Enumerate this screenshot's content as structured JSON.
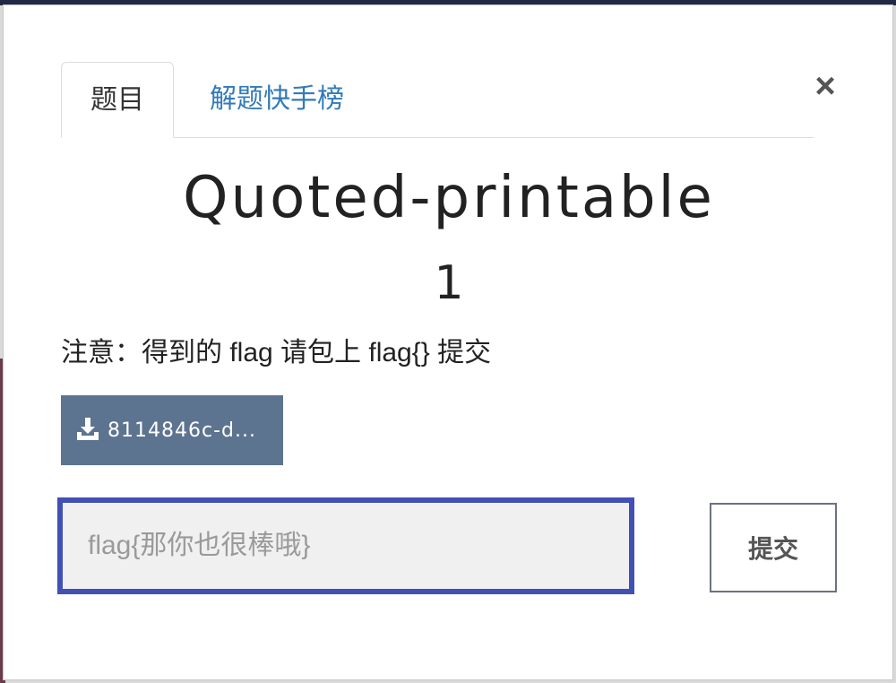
{
  "tabs": [
    {
      "label": "题目",
      "active": true
    },
    {
      "label": "解题快手榜",
      "active": false
    }
  ],
  "close_glyph": "×",
  "challenge": {
    "title": "Quoted-printable",
    "points": "1",
    "note": "注意：得到的 flag 请包上 flag{} 提交",
    "file_label": "8114846c-d...",
    "file_icon": "download-icon"
  },
  "form": {
    "flag_placeholder": "flag{那你也很棒哦}",
    "flag_value": "",
    "submit_label": "提交"
  },
  "colors": {
    "download_button": "#5d7490",
    "input_focus_border": "#4150b5",
    "link": "#337ab7"
  }
}
